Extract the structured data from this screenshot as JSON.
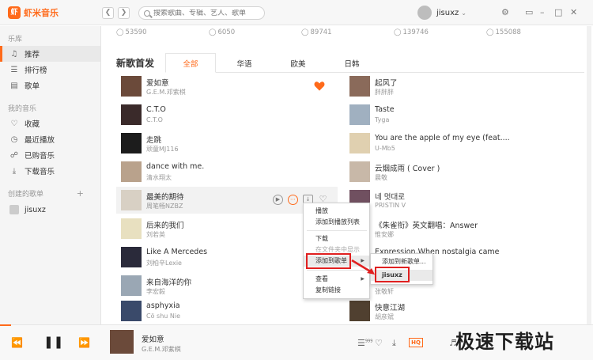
{
  "app": {
    "logo_glyph": "虾",
    "name": "虾米音乐",
    "accent": "#ff6a1a"
  },
  "search": {
    "placeholder": "搜索歌曲、专辑、艺人、歌单"
  },
  "user": {
    "name": "jisuxz"
  },
  "sidebar": {
    "library_head": "乐库",
    "library_items": [
      {
        "label": "推荐",
        "icon": "music-note-icon"
      },
      {
        "label": "排行榜",
        "icon": "ranking-icon"
      },
      {
        "label": "歌单",
        "icon": "playlist-icon"
      }
    ],
    "mymusic_head": "我的音乐",
    "mymusic_items": [
      {
        "label": "收藏",
        "icon": "heart-icon"
      },
      {
        "label": "最近播放",
        "icon": "clock-icon"
      },
      {
        "label": "已购音乐",
        "icon": "cart-icon"
      },
      {
        "label": "下载音乐",
        "icon": "download-icon"
      }
    ],
    "created_head": "创建的歌单",
    "created_plus": "+",
    "playlists": [
      {
        "label": "jisuxz"
      }
    ]
  },
  "top_counts": [
    "53590",
    "6050",
    "89741",
    "139746",
    "155088"
  ],
  "section": {
    "title": "新歌首发",
    "tabs": [
      "全部",
      "华语",
      "欧美",
      "日韩"
    ],
    "active_tab": "全部"
  },
  "songs_left": [
    {
      "title": "爱如意",
      "artist": "G.E.M.邓紫棋",
      "cover": "#6b4a3a"
    },
    {
      "title": "C.T.O",
      "artist": "C.T.O",
      "cover": "#3a2a2a"
    },
    {
      "title": "走跳",
      "artist": "顽童MJ116",
      "cover": "#1c1c1c"
    },
    {
      "title": "dance with me.",
      "artist": "清水翔太",
      "cover": "#b9a28c"
    },
    {
      "title": "最美的期待",
      "artist": "周笔畅NZBZ",
      "cover": "#d8d0c4"
    },
    {
      "title": "后来的我们",
      "artist": "刘若英",
      "cover": "#e8e0c0"
    },
    {
      "title": "Like A Mercedes",
      "artist": "刘柏辛Lexie",
      "cover": "#2a2a3a"
    },
    {
      "title": "来自海洋的你",
      "artist": "李宏毅",
      "cover": "#9aa7b4"
    },
    {
      "title": "asphyxia",
      "artist": "Cö shu Nie",
      "cover": "#3a4a6a"
    }
  ],
  "songs_right": [
    {
      "title": "起风了",
      "artist": "胖胖胖",
      "cover": "#8a6a5a"
    },
    {
      "title": "Taste",
      "artist": "Tyga",
      "cover": "#a0b0c0"
    },
    {
      "title": "You are the apple of my eye (feat....",
      "artist": "U-Mb5",
      "cover": "#e0d0b0"
    },
    {
      "title": "云烟成雨 ( Cover )",
      "artist": "晨敬",
      "cover": "#c8b8a8"
    },
    {
      "title": "네 멋대로",
      "artist": "PRISTIN V",
      "cover": "#705060"
    },
    {
      "title": "《朱雀衔》英文翻唱：Answer",
      "artist": "惟安娜",
      "cover": "#c0a080"
    },
    {
      "title": "Expression,When nostalgia came",
      "artist": "",
      "cover": "#807060"
    },
    {
      "title": "",
      "artist": "张敬轩",
      "cover": "#3a3a3a"
    },
    {
      "title": "快意江湖",
      "artist": "胡彦斌",
      "cover": "#504030"
    }
  ],
  "context_menu": {
    "items": [
      "播放",
      "添加到播放列表",
      "下载",
      "在文件夹中显示",
      "添加到歌单",
      "查看",
      "复制链接"
    ]
  },
  "submenu": {
    "items": [
      "添加到新歌单...",
      "jisuxz"
    ]
  },
  "player": {
    "title": "爱如意",
    "artist": "G.E.M.邓紫棋",
    "quality": "HQ",
    "comment_count": "999"
  },
  "watermark": "极速下载站"
}
